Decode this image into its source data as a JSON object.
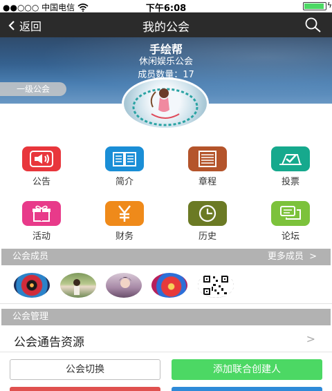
{
  "status_bar": {
    "carrier": "●●○○○ 中国电信",
    "time": "下午6:08"
  },
  "nav": {
    "back_label": "返回",
    "title": "我的公会",
    "search_icon": "search-icon"
  },
  "guild": {
    "name": "手绘帮",
    "type": "休闲娱乐公会",
    "members_label": "成员数量：",
    "members_count": "17",
    "level_badge": "一级公会"
  },
  "features": [
    {
      "label": "公告",
      "icon": "speaker-icon",
      "color": "#e8363c"
    },
    {
      "label": "简介",
      "icon": "book-icon",
      "color": "#1a8ed6"
    },
    {
      "label": "章程",
      "icon": "list-icon",
      "color": "#b4542b"
    },
    {
      "label": "投票",
      "icon": "vote-icon",
      "color": "#16a98d"
    },
    {
      "label": "活动",
      "icon": "gift-icon",
      "color": "#e83a8a"
    },
    {
      "label": "财务",
      "icon": "yen-icon",
      "color": "#ef8a1a"
    },
    {
      "label": "历史",
      "icon": "clock-icon",
      "color": "#6b7a24"
    },
    {
      "label": "论坛",
      "icon": "chat-icon",
      "color": "#7cc23b"
    }
  ],
  "members_section": {
    "title": "公会成员",
    "more": "更多成员",
    "more_icon": "chevron-right-icon"
  },
  "management_section": {
    "title": "公会管理",
    "link": "公会通告资源",
    "link_icon": "chevron-right-icon"
  },
  "buttons": {
    "switch": "公会切换",
    "add_founder": "添加联合创建人"
  },
  "colors": {
    "nav_bg": "#2b2b2b",
    "section_bg": "#b2b2b2",
    "accent_green": "#4cd864"
  }
}
